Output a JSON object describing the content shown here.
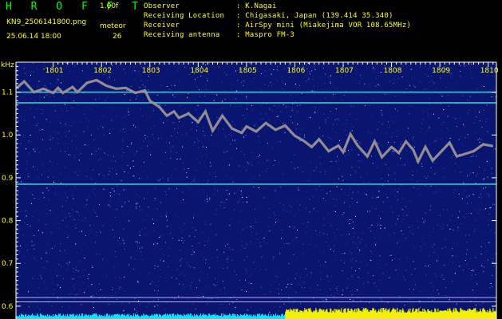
{
  "header": {
    "app_title": "H R O F F T",
    "version": "1.00f",
    "filename": "KN9_2506141800.png",
    "datetime": "25.06.14 18:00",
    "meteor_label": "meteor",
    "meteor_count": "26",
    "info": [
      {
        "key": "Observer",
        "value": ": K.Nagai"
      },
      {
        "key": "Receiving Location",
        "value": ": Chigasaki, Japan (139.414 35.340)"
      },
      {
        "key": "Receiver",
        "value": ": AirSpy mini (Miakejima VOR 108.65MHz)"
      },
      {
        "key": "Receiving antenna",
        "value": ": Maspro FM-3"
      }
    ]
  },
  "colors": {
    "header_text": "#ffff00",
    "title_text": "#00ff00",
    "background": "#000000",
    "noise_blue": "#1a2a9a",
    "signal_line": "#40d8d0",
    "doppler_trace": "#ff6060",
    "baseline_cyan": "#00e8ff",
    "baseline_yellow": "#ffff00"
  },
  "chart_data": {
    "type": "line",
    "ylabel": "kHz",
    "yticks": [
      "1.1",
      "1.0",
      "0.9",
      "0.8",
      "0.7",
      "0.6"
    ],
    "ylim": [
      0.57,
      1.17
    ],
    "xticks": [
      "1801",
      "1802",
      "1803",
      "1804",
      "1805",
      "1806",
      "1807",
      "1808",
      "1809",
      "1810"
    ],
    "xlim": [
      1800.23,
      1810.17
    ],
    "horizontal_lines_khz": [
      1.1,
      1.075,
      0.885,
      0.62,
      0.61
    ],
    "trace_khz": [
      [
        1800.25,
        1.11
      ],
      [
        1800.4,
        1.125
      ],
      [
        1800.6,
        1.1
      ],
      [
        1800.8,
        1.108
      ],
      [
        1801.0,
        1.098
      ],
      [
        1801.1,
        1.11
      ],
      [
        1801.2,
        1.098
      ],
      [
        1801.4,
        1.112
      ],
      [
        1801.5,
        1.1
      ],
      [
        1801.7,
        1.122
      ],
      [
        1801.9,
        1.128
      ],
      [
        1802.1,
        1.115
      ],
      [
        1802.3,
        1.108
      ],
      [
        1802.5,
        1.11
      ],
      [
        1802.7,
        1.098
      ],
      [
        1802.9,
        1.104
      ],
      [
        1803.0,
        1.08
      ],
      [
        1803.2,
        1.065
      ],
      [
        1803.35,
        1.045
      ],
      [
        1803.5,
        1.055
      ],
      [
        1803.6,
        1.04
      ],
      [
        1803.8,
        1.05
      ],
      [
        1804.0,
        1.03
      ],
      [
        1804.15,
        1.055
      ],
      [
        1804.3,
        1.01
      ],
      [
        1804.5,
        1.045
      ],
      [
        1804.7,
        1.015
      ],
      [
        1804.9,
        1.005
      ],
      [
        1805.0,
        1.02
      ],
      [
        1805.2,
        1.008
      ],
      [
        1805.4,
        1.028
      ],
      [
        1805.6,
        1.012
      ],
      [
        1805.8,
        1.022
      ],
      [
        1806.0,
        0.998
      ],
      [
        1806.2,
        0.985
      ],
      [
        1806.35,
        0.972
      ],
      [
        1806.5,
        0.99
      ],
      [
        1806.7,
        0.962
      ],
      [
        1806.9,
        0.975
      ],
      [
        1807.0,
        0.96
      ],
      [
        1807.15,
        1.002
      ],
      [
        1807.3,
        0.975
      ],
      [
        1807.5,
        0.95
      ],
      [
        1807.65,
        0.985
      ],
      [
        1807.8,
        0.948
      ],
      [
        1808.0,
        0.972
      ],
      [
        1808.15,
        0.958
      ],
      [
        1808.3,
        0.985
      ],
      [
        1808.45,
        0.965
      ],
      [
        1808.55,
        0.938
      ],
      [
        1808.7,
        0.972
      ],
      [
        1808.85,
        0.94
      ],
      [
        1809.0,
        0.958
      ],
      [
        1809.2,
        0.982
      ],
      [
        1809.35,
        0.95
      ],
      [
        1809.5,
        0.955
      ],
      [
        1809.7,
        0.962
      ],
      [
        1809.9,
        0.978
      ],
      [
        1810.1,
        0.974
      ]
    ],
    "baseline_segments": [
      {
        "x_start": 1800.23,
        "x_end": 1805.8,
        "color": "#00e8ff"
      },
      {
        "x_start": 1805.8,
        "x_end": 1810.17,
        "color": "#ffff00"
      }
    ]
  }
}
